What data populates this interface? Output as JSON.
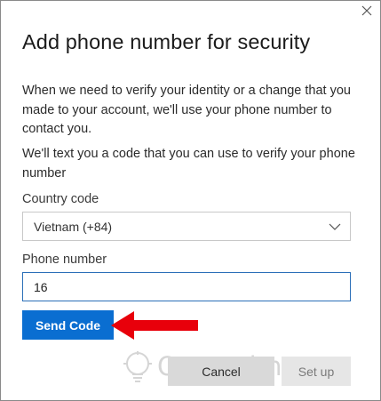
{
  "dialog": {
    "title": "Add phone number for security",
    "description": "When we need to verify your identity or a change that you made to your account, we'll use your phone number to contact you.",
    "sms_note": "We'll text you a code that you can use to verify your phone number"
  },
  "country": {
    "label": "Country code",
    "selected": "Vietnam (+84)"
  },
  "phone": {
    "label": "Phone number",
    "value": "16"
  },
  "actions": {
    "send_code": "Send Code",
    "cancel": "Cancel",
    "setup": "Set up"
  },
  "watermark": {
    "text": "Quantrimang"
  },
  "colors": {
    "primary": "#0a6ed1",
    "arrow": "#e8000b",
    "input_border": "#2b6fb8"
  },
  "icons": {
    "close": "close-icon",
    "dropdown": "chevron-down-icon",
    "annotation": "red-arrow-icon"
  }
}
